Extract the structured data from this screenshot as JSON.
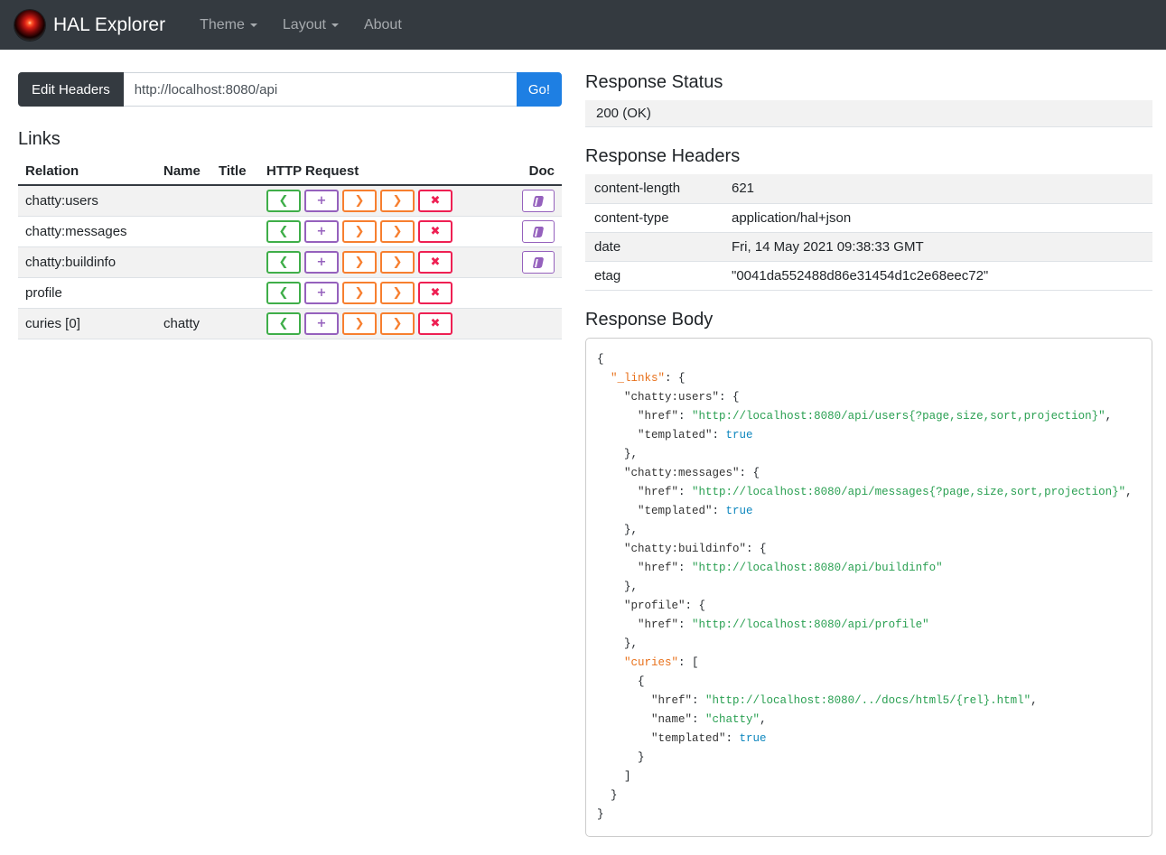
{
  "navbar": {
    "brand": "HAL Explorer",
    "items": [
      {
        "label": "Theme",
        "dropdown": true
      },
      {
        "label": "Layout",
        "dropdown": true
      },
      {
        "label": "About",
        "dropdown": false
      }
    ]
  },
  "request_bar": {
    "edit_headers_label": "Edit Headers",
    "url_value": "http://localhost:8080/api",
    "go_label": "Go!"
  },
  "colors": {
    "accent_primary": "#1e7fe3",
    "http_get": "#3fae49",
    "http_post": "#9561bd",
    "http_put": "#f77f2f",
    "http_patch": "#f77f2f",
    "http_delete": "#ee2053",
    "doc_purple": "#9561bd",
    "json_key": "#333333",
    "json_special_key": "#e8701a",
    "json_string": "#2aa052",
    "json_boolean": "#0e87be",
    "json_punct": "#24292e"
  },
  "links": {
    "title": "Links",
    "columns": [
      "Relation",
      "Name",
      "Title",
      "HTTP Request",
      "Doc"
    ],
    "request_buttons": [
      {
        "name": "get-request-button",
        "glyph": "❮",
        "color": "#3fae49"
      },
      {
        "name": "post-request-button",
        "glyph": "+",
        "color": "#9561bd"
      },
      {
        "name": "put-request-button",
        "glyph": "❯",
        "color": "#f77f2f"
      },
      {
        "name": "patch-request-button",
        "glyph": "❯",
        "color": "#f77f2f"
      },
      {
        "name": "delete-request-button",
        "glyph": "✖",
        "color": "#ee2053"
      }
    ],
    "rows": [
      {
        "relation": "chatty:users",
        "name": "",
        "title": "",
        "doc": true
      },
      {
        "relation": "chatty:messages",
        "name": "",
        "title": "",
        "doc": true
      },
      {
        "relation": "chatty:buildinfo",
        "name": "",
        "title": "",
        "doc": true
      },
      {
        "relation": "profile",
        "name": "",
        "title": "",
        "doc": false
      },
      {
        "relation": "curies [0]",
        "name": "chatty",
        "title": "",
        "doc": false
      }
    ]
  },
  "response_status": {
    "title": "Response Status",
    "value": "200 (OK)"
  },
  "response_headers": {
    "title": "Response Headers",
    "rows": [
      [
        "content-length",
        "621"
      ],
      [
        "content-type",
        "application/hal+json"
      ],
      [
        "date",
        "Fri, 14 May 2021 09:38:33 GMT"
      ],
      [
        "etag",
        "\"0041da552488d86e31454d1c2e68eec72\""
      ]
    ]
  },
  "response_body": {
    "title": "Response Body",
    "lines": [
      [
        [
          "p",
          "{"
        ]
      ],
      [
        [
          "p",
          "  "
        ],
        [
          "o",
          "\"_links\""
        ],
        [
          "p",
          ": {"
        ]
      ],
      [
        [
          "p",
          "    "
        ],
        [
          "k",
          "\"chatty:users\""
        ],
        [
          "p",
          ": {"
        ]
      ],
      [
        [
          "p",
          "      "
        ],
        [
          "k",
          "\"href\""
        ],
        [
          "p",
          ": "
        ],
        [
          "s",
          "\"http://localhost:8080/api/users{?page,size,sort,projection}\""
        ],
        [
          "p",
          ","
        ]
      ],
      [
        [
          "p",
          "      "
        ],
        [
          "k",
          "\"templated\""
        ],
        [
          "p",
          ": "
        ],
        [
          "b",
          "true"
        ]
      ],
      [
        [
          "p",
          "    },"
        ]
      ],
      [
        [
          "p",
          "    "
        ],
        [
          "k",
          "\"chatty:messages\""
        ],
        [
          "p",
          ": {"
        ]
      ],
      [
        [
          "p",
          "      "
        ],
        [
          "k",
          "\"href\""
        ],
        [
          "p",
          ": "
        ],
        [
          "s",
          "\"http://localhost:8080/api/messages{?page,size,sort,projection}\""
        ],
        [
          "p",
          ","
        ]
      ],
      [
        [
          "p",
          "      "
        ],
        [
          "k",
          "\"templated\""
        ],
        [
          "p",
          ": "
        ],
        [
          "b",
          "true"
        ]
      ],
      [
        [
          "p",
          "    },"
        ]
      ],
      [
        [
          "p",
          "    "
        ],
        [
          "k",
          "\"chatty:buildinfo\""
        ],
        [
          "p",
          ": {"
        ]
      ],
      [
        [
          "p",
          "      "
        ],
        [
          "k",
          "\"href\""
        ],
        [
          "p",
          ": "
        ],
        [
          "s",
          "\"http://localhost:8080/api/buildinfo\""
        ]
      ],
      [
        [
          "p",
          "    },"
        ]
      ],
      [
        [
          "p",
          "    "
        ],
        [
          "k",
          "\"profile\""
        ],
        [
          "p",
          ": {"
        ]
      ],
      [
        [
          "p",
          "      "
        ],
        [
          "k",
          "\"href\""
        ],
        [
          "p",
          ": "
        ],
        [
          "s",
          "\"http://localhost:8080/api/profile\""
        ]
      ],
      [
        [
          "p",
          "    },"
        ]
      ],
      [
        [
          "p",
          "    "
        ],
        [
          "o",
          "\"curies\""
        ],
        [
          "p",
          ": ["
        ]
      ],
      [
        [
          "p",
          "      {"
        ]
      ],
      [
        [
          "p",
          "        "
        ],
        [
          "k",
          "\"href\""
        ],
        [
          "p",
          ": "
        ],
        [
          "s",
          "\"http://localhost:8080/../docs/html5/{rel}.html\""
        ],
        [
          "p",
          ","
        ]
      ],
      [
        [
          "p",
          "        "
        ],
        [
          "k",
          "\"name\""
        ],
        [
          "p",
          ": "
        ],
        [
          "s",
          "\"chatty\""
        ],
        [
          "p",
          ","
        ]
      ],
      [
        [
          "p",
          "        "
        ],
        [
          "k",
          "\"templated\""
        ],
        [
          "p",
          ": "
        ],
        [
          "b",
          "true"
        ]
      ],
      [
        [
          "p",
          "      }"
        ]
      ],
      [
        [
          "p",
          "    ]"
        ]
      ],
      [
        [
          "p",
          "  }"
        ]
      ],
      [
        [
          "p",
          "}"
        ]
      ]
    ]
  }
}
